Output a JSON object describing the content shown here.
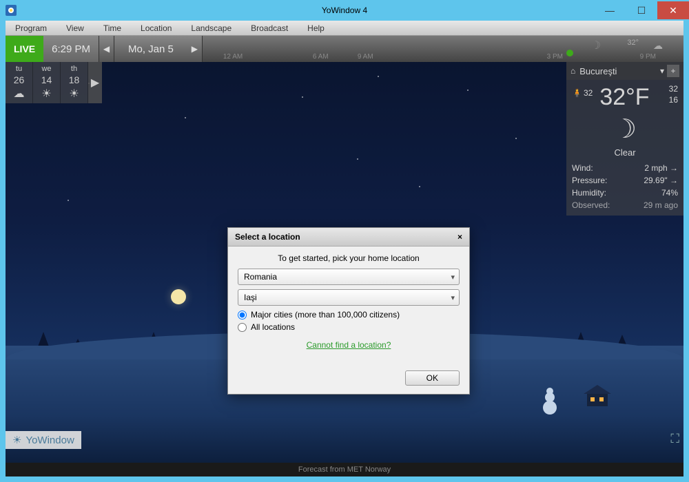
{
  "window": {
    "title": "YoWindow 4"
  },
  "menu": {
    "items": [
      "Program",
      "View",
      "Time",
      "Location",
      "Landscape",
      "Broadcast",
      "Help"
    ]
  },
  "topbar": {
    "live": "LIVE",
    "time": "6:29 PM",
    "date": "Mo, Jan 5",
    "ticks": [
      "12 AM",
      "6 AM",
      "9 AM",
      "3 PM",
      "9 PM"
    ],
    "indicator_temp": "32°"
  },
  "forecast": [
    {
      "day": "tu",
      "temp": "26",
      "icon": "☁"
    },
    {
      "day": "we",
      "temp": "14",
      "icon": "☀"
    },
    {
      "day": "th",
      "temp": "18",
      "icon": "☀"
    }
  ],
  "panel": {
    "location": "Bucureşti",
    "feels_like": "32",
    "temp": "32°F",
    "high": "32",
    "low": "16",
    "condition": "Clear",
    "wind_label": "Wind:",
    "wind": "2 mph →",
    "pressure_label": "Pressure:",
    "pressure": "29.69\" →",
    "humidity_label": "Humidity:",
    "humidity": "74%",
    "observed_label": "Observed:",
    "observed": "29 m ago"
  },
  "modal": {
    "title": "Select a location",
    "prompt": "To get started, pick your home location",
    "country": "Romania",
    "city": "Iaşi",
    "opt_major": "Major cities (more than 100,000 citizens)",
    "opt_all": "All locations",
    "help": "Cannot find a location?",
    "ok": "OK"
  },
  "logo": "YoWindow",
  "footer": "Forecast from MET Norway"
}
